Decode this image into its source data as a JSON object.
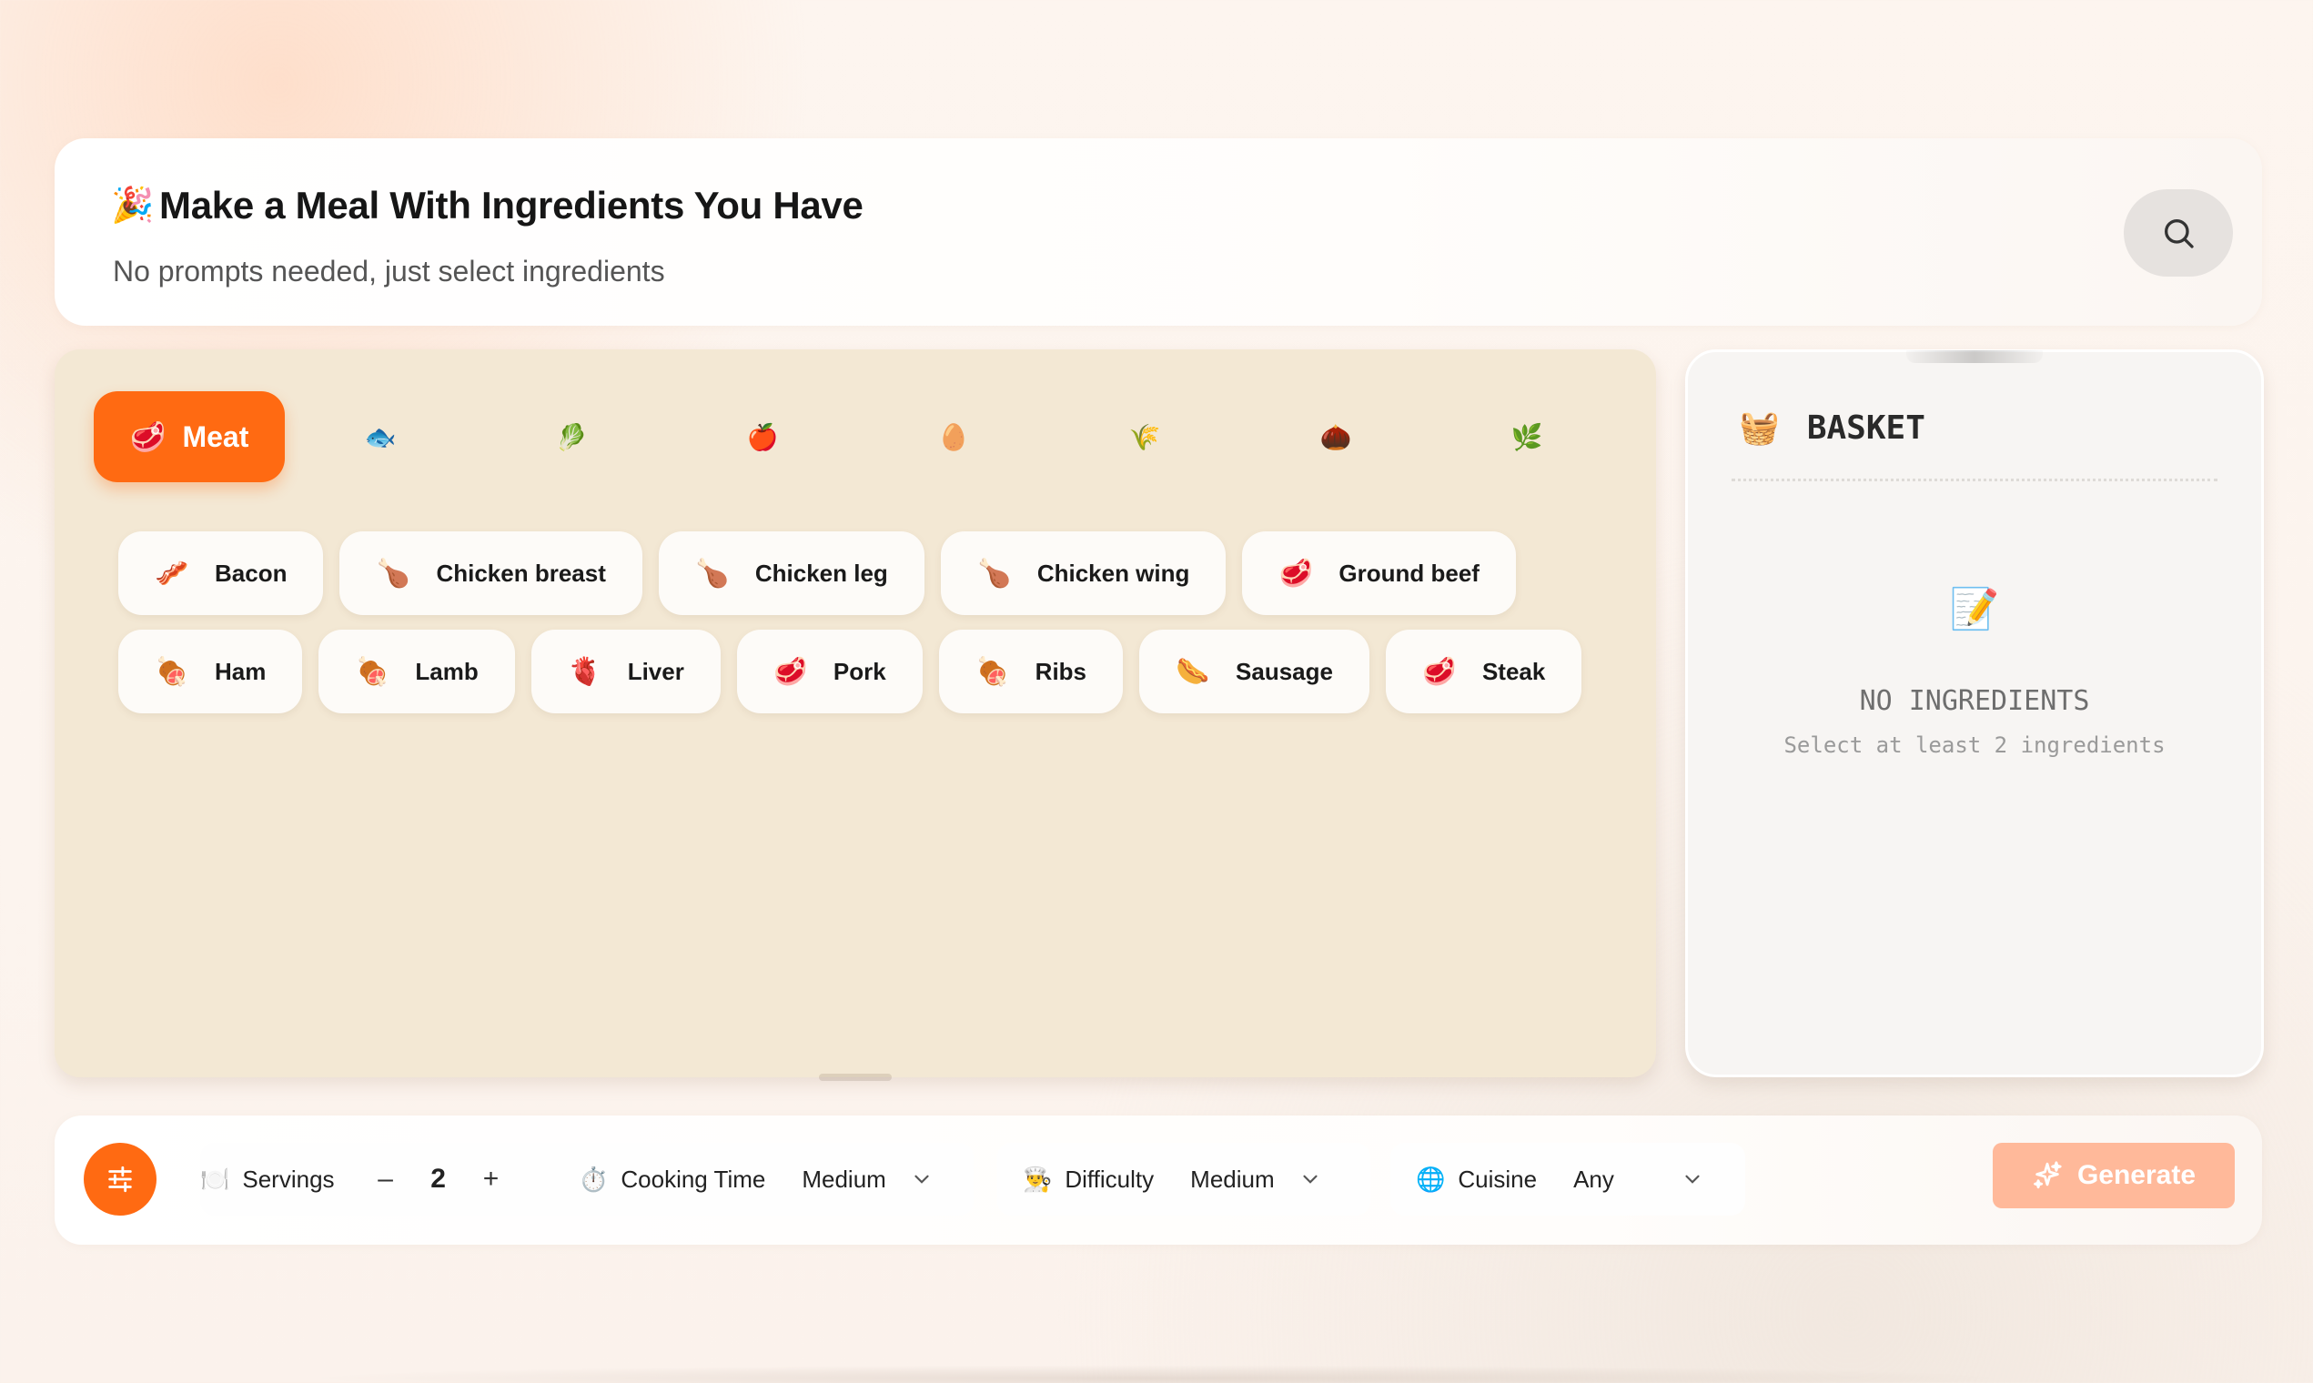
{
  "header": {
    "title_emoji": "🎉",
    "title": "Make a Meal With Ingredients You Have",
    "subtitle": "No prompts needed, just select ingredients"
  },
  "categories": {
    "active": {
      "icon": "🥩",
      "label": "Meat"
    },
    "others": [
      {
        "icon": "🐟",
        "name": "fish"
      },
      {
        "icon": "🥬",
        "name": "vegetables"
      },
      {
        "icon": "🍎",
        "name": "fruits"
      },
      {
        "icon": "🥚",
        "name": "eggs"
      },
      {
        "icon": "🌾",
        "name": "grains"
      },
      {
        "icon": "🌰",
        "name": "nuts"
      },
      {
        "icon": "🌿",
        "name": "herbs"
      }
    ]
  },
  "ingredients": {
    "row1": [
      {
        "icon": "🥓",
        "label": "Bacon"
      },
      {
        "icon": "🍗",
        "label": "Chicken breast"
      },
      {
        "icon": "🍗",
        "label": "Chicken leg"
      },
      {
        "icon": "🍗",
        "label": "Chicken wing"
      },
      {
        "icon": "🥩",
        "label": "Ground beef"
      }
    ],
    "row2": [
      {
        "icon": "🍖",
        "label": "Ham"
      },
      {
        "icon": "🍖",
        "label": "Lamb"
      },
      {
        "icon": "🫀",
        "label": "Liver"
      },
      {
        "icon": "🥩",
        "label": "Pork"
      },
      {
        "icon": "🍖",
        "label": "Ribs"
      },
      {
        "icon": "🌭",
        "label": "Sausage"
      },
      {
        "icon": "🥩",
        "label": "Steak"
      }
    ]
  },
  "basket": {
    "icon": "🧺",
    "title": "BASKET",
    "empty_icon": "📝",
    "empty_title": "NO INGREDIENTS",
    "empty_hint": "Select at least 2 ingredients"
  },
  "controls": {
    "servings": {
      "icon": "🍽️",
      "label": "Servings",
      "minus": "–",
      "value": "2",
      "plus": "+"
    },
    "cooking_time": {
      "icon": "⏱️",
      "label": "Cooking Time",
      "value": "Medium"
    },
    "difficulty": {
      "icon": "👨‍🍳",
      "label": "Difficulty",
      "value": "Medium"
    },
    "cuisine": {
      "icon": "🌐",
      "label": "Cuisine",
      "value": "Any"
    },
    "generate_label": "Generate"
  },
  "colors": {
    "accent": "#ff6a12",
    "generate_disabled": "#ffb99a",
    "panel_bg": "#f3e8d4"
  }
}
